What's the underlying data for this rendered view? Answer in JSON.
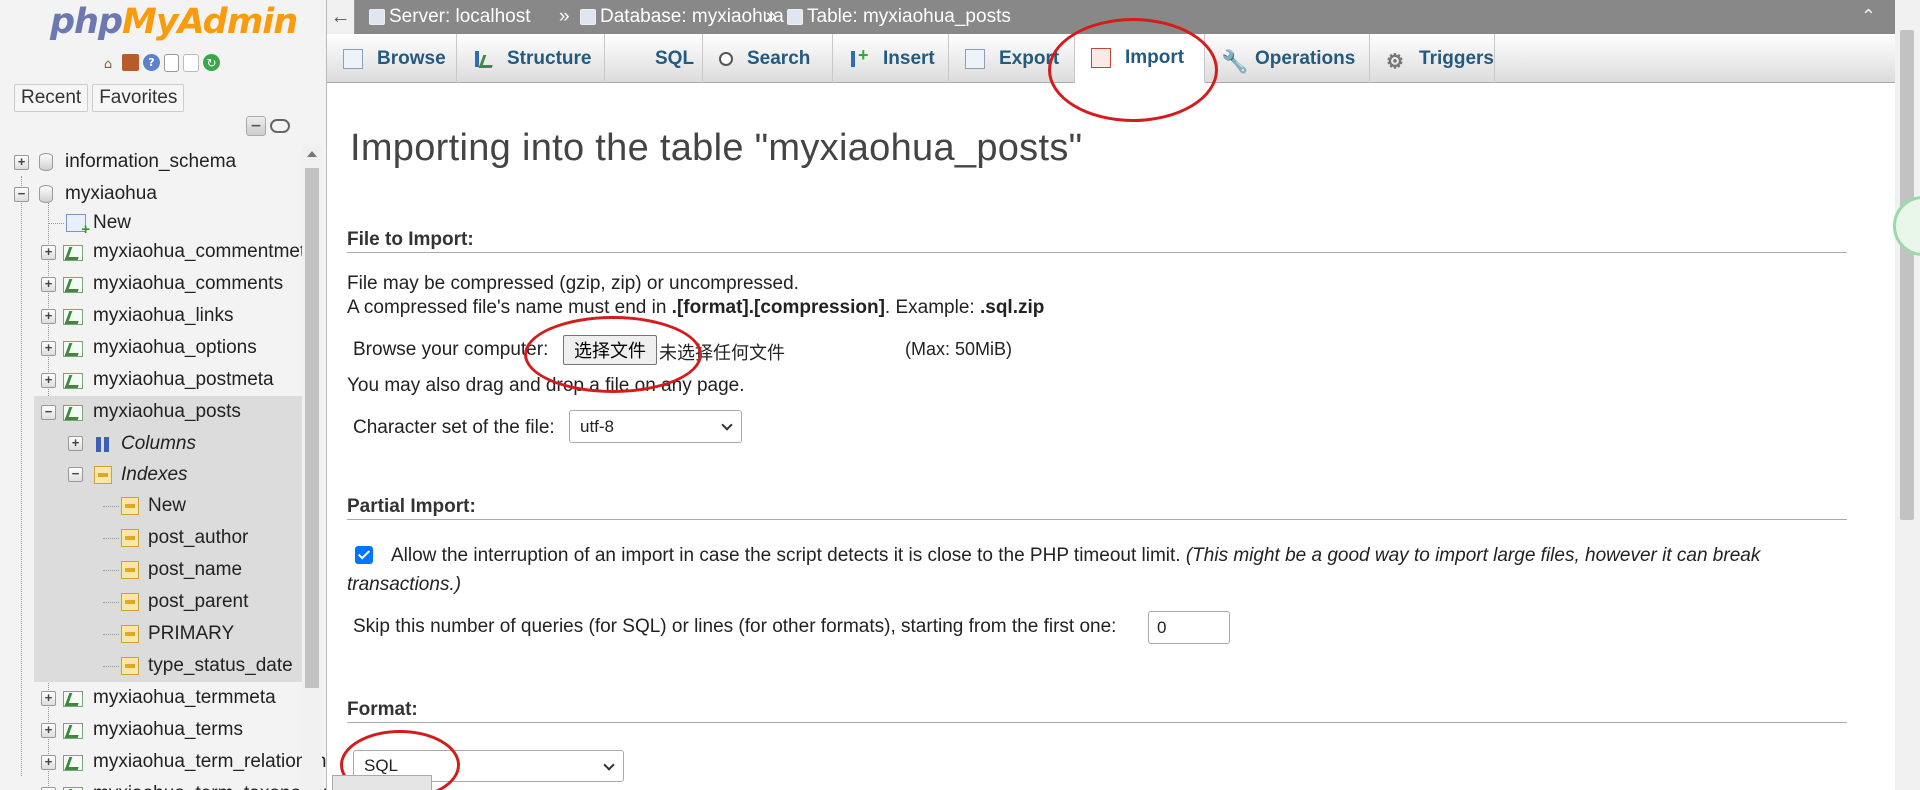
{
  "sidebar": {
    "logo_php": "php",
    "logo_myadmin": "MyAdmin",
    "quick_icons": [
      "home-icon",
      "exit-icon",
      "help-icon",
      "docs-icon",
      "settings-icon",
      "reload-icon"
    ],
    "tabs": [
      "Recent",
      "Favorites"
    ],
    "tree": {
      "db1": "information_schema",
      "db2": "myxiaohua",
      "new": "New",
      "tables": [
        "myxiaohua_commentmeta",
        "myxiaohua_comments",
        "myxiaohua_links",
        "myxiaohua_options",
        "myxiaohua_postmeta",
        "myxiaohua_posts"
      ],
      "columns": "Columns",
      "indexes": "Indexes",
      "index_new": "New",
      "index_items": [
        "post_author",
        "post_name",
        "post_parent",
        "PRIMARY",
        "type_status_date"
      ],
      "tables_after": [
        "myxiaohua_termmeta",
        "myxiaohua_terms",
        "myxiaohua_term_relationships",
        "myxiaohua_term_taxonomy"
      ]
    }
  },
  "breadcrumb": {
    "server": "Server: localhost",
    "database": "Database: myxiaohua",
    "table": "Table: myxiaohua_posts",
    "sep": "»"
  },
  "tabs": [
    "Browse",
    "Structure",
    "SQL",
    "Search",
    "Insert",
    "Export",
    "Import",
    "Operations",
    "Triggers"
  ],
  "active_tab": "Import",
  "main": {
    "title": "Importing into the table \"myxiaohua_posts\"",
    "file_section": {
      "heading": "File to Import:",
      "line1": "File may be compressed (gzip, zip) or uncompressed.",
      "line2_pre": "A compressed file's name must end in ",
      "line2_bold": ".[format].[compression]",
      "line2_mid": ". Example: ",
      "line2_example": ".sql.zip",
      "browse_label": "Browse your computer:",
      "file_button": "选择文件",
      "no_file": "未选择任何文件",
      "max": "(Max: 50MiB)",
      "drag_hint": "You may also drag and drop a file on any page.",
      "charset_label": "Character set of the file:",
      "charset_value": "utf-8"
    },
    "partial_section": {
      "heading": "Partial Import:",
      "allow_text": "Allow the interruption of an import in case the script detects it is close to the PHP timeout limit.",
      "allow_italic_1": "(This might be a good way to import large files, however it can break",
      "allow_italic_2": "transactions.)",
      "skip_label": "Skip this number of queries (for SQL) or lines (for other formats), starting from the first one:",
      "skip_value": "0"
    },
    "format_section": {
      "heading": "Format:",
      "format_value": "SQL"
    }
  },
  "colors": {
    "accent_link": "#235a81",
    "annotation_red": "#d41c1c",
    "topbar": "#888888"
  }
}
